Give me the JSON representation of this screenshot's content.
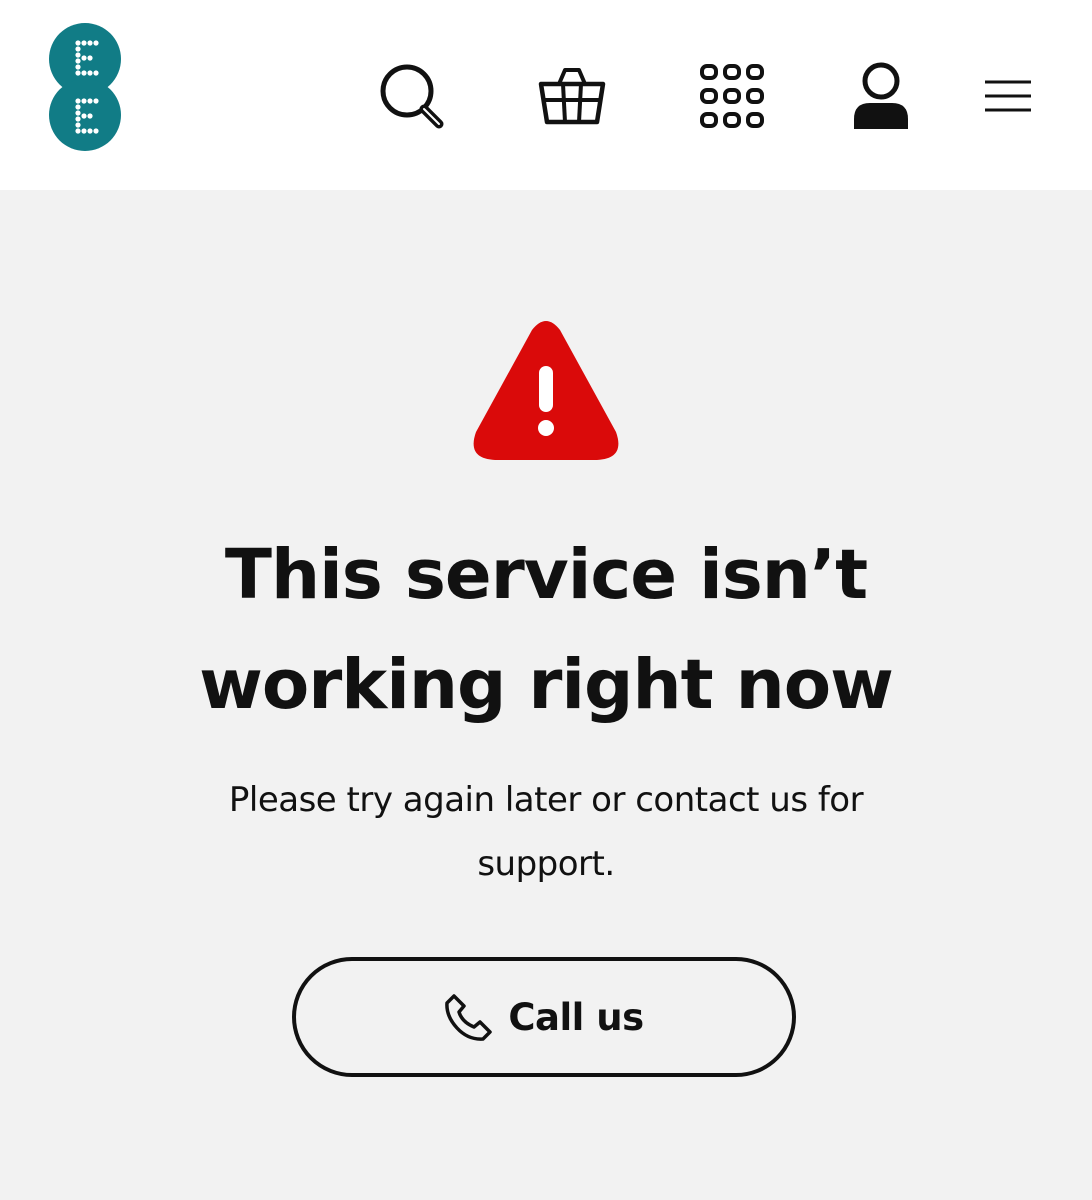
{
  "colors": {
    "brand": "#117c86",
    "warning": "#da0a0a",
    "text": "#111111",
    "background": "#f2f2f2",
    "header_background": "#ffffff"
  },
  "header": {
    "logo": "ee-logo",
    "icons": [
      "search-icon",
      "basket-icon",
      "apps-grid-icon",
      "account-icon",
      "menu-icon"
    ]
  },
  "main": {
    "icon": "warning-icon",
    "title_line1": "This service isn’t",
    "title_line2": "working right now",
    "message_line1": "Please try again later or contact us for",
    "message_line2": "support.",
    "call_button": {
      "icon": "phone-icon",
      "label": "Call us"
    }
  }
}
